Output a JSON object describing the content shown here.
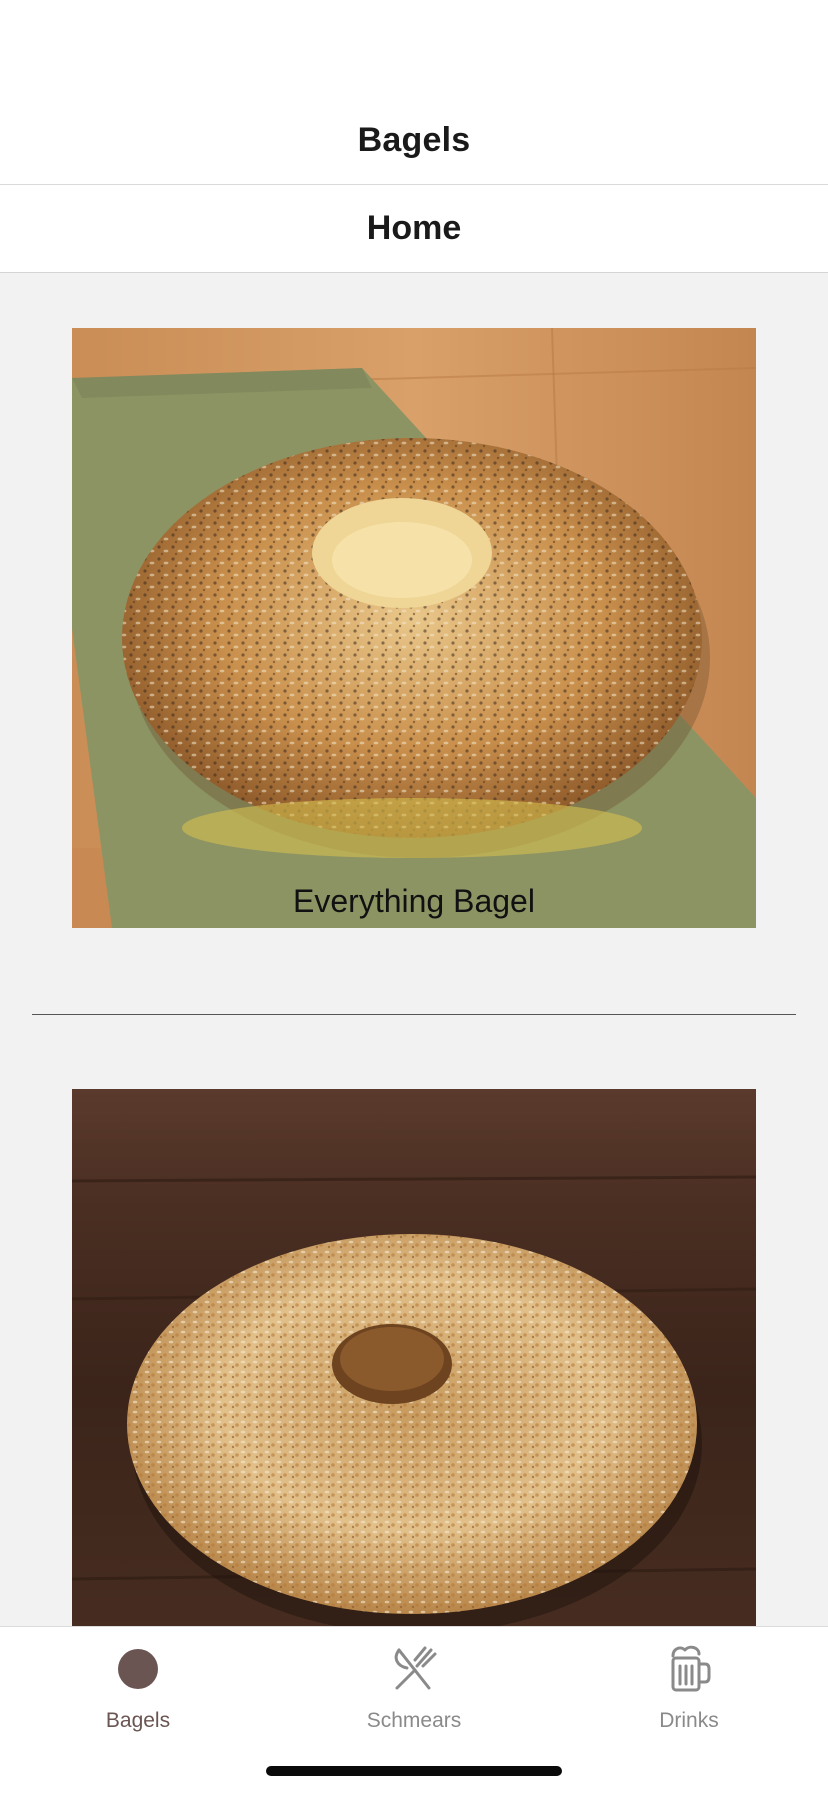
{
  "header": {
    "title": "Bagels",
    "subtitle": "Home"
  },
  "products": [
    {
      "name": "Everything Bagel",
      "image_icon": "everything-bagel-photo"
    },
    {
      "name": "",
      "image_icon": "garlic-bagel-photo"
    }
  ],
  "tab_bar": {
    "tabs": [
      {
        "label": "Bagels",
        "icon": "bagel-icon",
        "active": true
      },
      {
        "label": "Schmears",
        "icon": "utensils-icon",
        "active": false
      },
      {
        "label": "Drinks",
        "icon": "beer-mug-icon",
        "active": false
      }
    ]
  },
  "colors": {
    "accent": "#6a5552",
    "inactive": "#8a8a8a",
    "background": "#f2f2f2"
  }
}
